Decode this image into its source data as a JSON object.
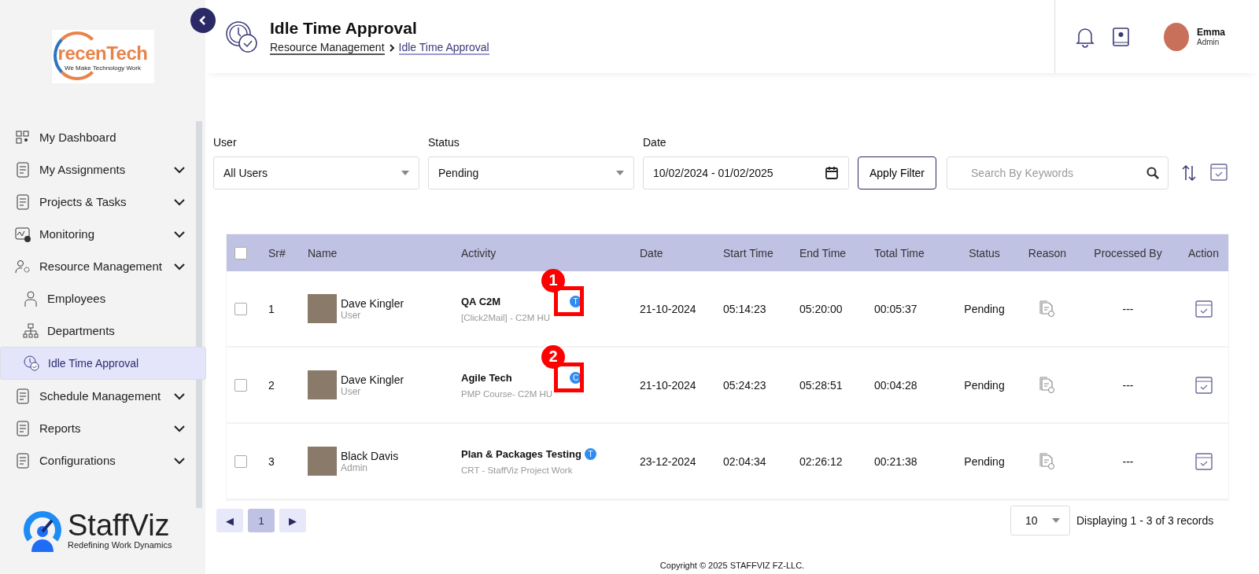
{
  "sidebar": {
    "logo": {
      "brand": "recenTech",
      "tagline": "We Make Technology Work"
    },
    "items": [
      {
        "label": "My Dashboard",
        "expandable": false,
        "selected": false
      },
      {
        "label": "My Assignments",
        "expandable": true,
        "selected": false
      },
      {
        "label": "Projects & Tasks",
        "expandable": true,
        "selected": false
      },
      {
        "label": "Monitoring",
        "expandable": true,
        "selected": false
      },
      {
        "label": "Resource Management",
        "expandable": true,
        "selected": false,
        "children": [
          {
            "label": "Employees",
            "selected": false
          },
          {
            "label": "Departments",
            "selected": false
          },
          {
            "label": "Idle Time Approval",
            "selected": true
          }
        ]
      },
      {
        "label": "Schedule Management",
        "expandable": true,
        "selected": false
      },
      {
        "label": "Reports",
        "expandable": true,
        "selected": false
      },
      {
        "label": "Configurations",
        "expandable": true,
        "selected": false
      }
    ],
    "footer_logo": {
      "brand": "StaffViz",
      "tagline": "Redefining Work Dynamics"
    }
  },
  "header": {
    "title": "Idle Time Approval",
    "breadcrumb": [
      "Resource Management",
      "Idle Time Approval"
    ],
    "user": {
      "name": "Emma",
      "role": "Admin"
    }
  },
  "filters": {
    "user": {
      "label": "User",
      "value": "All Users"
    },
    "status": {
      "label": "Status",
      "value": "Pending"
    },
    "date": {
      "label": "Date",
      "value": "10/02/2024 - 01/02/2025"
    },
    "apply": "Apply Filter",
    "search": {
      "placeholder": "Search By Keywords"
    }
  },
  "table": {
    "columns": [
      "Sr#",
      "Name",
      "Activity",
      "Date",
      "Start Time",
      "End Time",
      "Total Time",
      "Status",
      "Reason",
      "Processed By",
      "Action"
    ],
    "all_checked": false,
    "rows": [
      {
        "checked": false,
        "sr": "1",
        "name": "Dave Kingler",
        "role": "User",
        "activity": "QA C2M",
        "badge": "T",
        "project": "[Click2Mail] - C2M HU",
        "date": "21-10-2024",
        "start": "05:14:23",
        "end": "05:20:00",
        "total": "00:05:37",
        "status": "Pending",
        "processed_by": "---",
        "callout": "1"
      },
      {
        "checked": false,
        "sr": "2",
        "name": "Dave Kingler",
        "role": "User",
        "activity": "Agile Tech",
        "badge": "C",
        "project": "PMP Course- C2M HU",
        "date": "21-10-2024",
        "start": "05:24:23",
        "end": "05:28:51",
        "total": "00:04:28",
        "status": "Pending",
        "processed_by": "---",
        "callout": "2"
      },
      {
        "checked": false,
        "sr": "3",
        "name": "Black Davis",
        "role": "Admin",
        "activity": "Plan & Packages Testing",
        "badge": "T",
        "project": "CRT - StaffViz Project Work",
        "date": "23-12-2024",
        "start": "02:04:34",
        "end": "02:26:12",
        "total": "00:21:38",
        "status": "Pending",
        "processed_by": "---"
      }
    ]
  },
  "pagination": {
    "prev": "◀",
    "pages": [
      {
        "label": "1",
        "selected": true
      }
    ],
    "next": "▶",
    "page_size": "10",
    "summary": "Displaying 1 - 3 of 3 records"
  },
  "footer": "Copyright © 2025 STAFFVIZ FZ-LLC."
}
